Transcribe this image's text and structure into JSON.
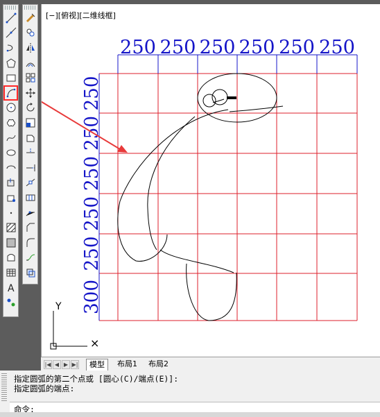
{
  "viewport": {
    "label": "[−][俯视][二维线框]"
  },
  "dimensions": {
    "top": [
      "250",
      "250",
      "250",
      "250",
      "250",
      "250"
    ],
    "left": [
      "250",
      "250",
      "250",
      "250",
      "250",
      "300"
    ]
  },
  "ucs": {
    "y_label": "Y",
    "x_label": "×"
  },
  "layout_tabs": [
    "模型",
    "布局1",
    "布局2"
  ],
  "nav_buttons": [
    "|◀",
    "◀",
    "▶",
    "▶|"
  ],
  "command": {
    "history": [
      "指定圆弧的第二个点或 [圆心(C)/端点(E)]:",
      "指定圆弧的端点:"
    ],
    "prompt": "命令:"
  },
  "toolbar_left": [
    "line-icon",
    "construction-line-icon",
    "polyline-icon",
    "polygon-icon",
    "rectangle-icon",
    "arc-icon",
    "circle-icon",
    "revision-cloud-icon",
    "spline-icon",
    "ellipse-icon",
    "ellipse-arc-icon",
    "insert-block-icon",
    "make-block-icon",
    "point-icon",
    "hatch-icon",
    "gradient-icon",
    "region-icon",
    "table-icon",
    "multiline-text-icon",
    "add-selected-icon"
  ],
  "toolbar_modify": [
    "erase-icon",
    "copy-icon",
    "mirror-icon",
    "offset-icon",
    "array-icon",
    "move-icon",
    "rotate-icon",
    "scale-icon",
    "stretch-icon",
    "trim-icon",
    "extend-icon",
    "break-at-point-icon",
    "break-icon",
    "join-icon",
    "chamfer-icon",
    "fillet-icon",
    "blend-curves-icon",
    "explode-icon"
  ],
  "colors": {
    "grid": "#dd1f2b",
    "dimension": "#1414c8",
    "arrow": "#e83a3a",
    "highlight": "#ff2a2a"
  }
}
